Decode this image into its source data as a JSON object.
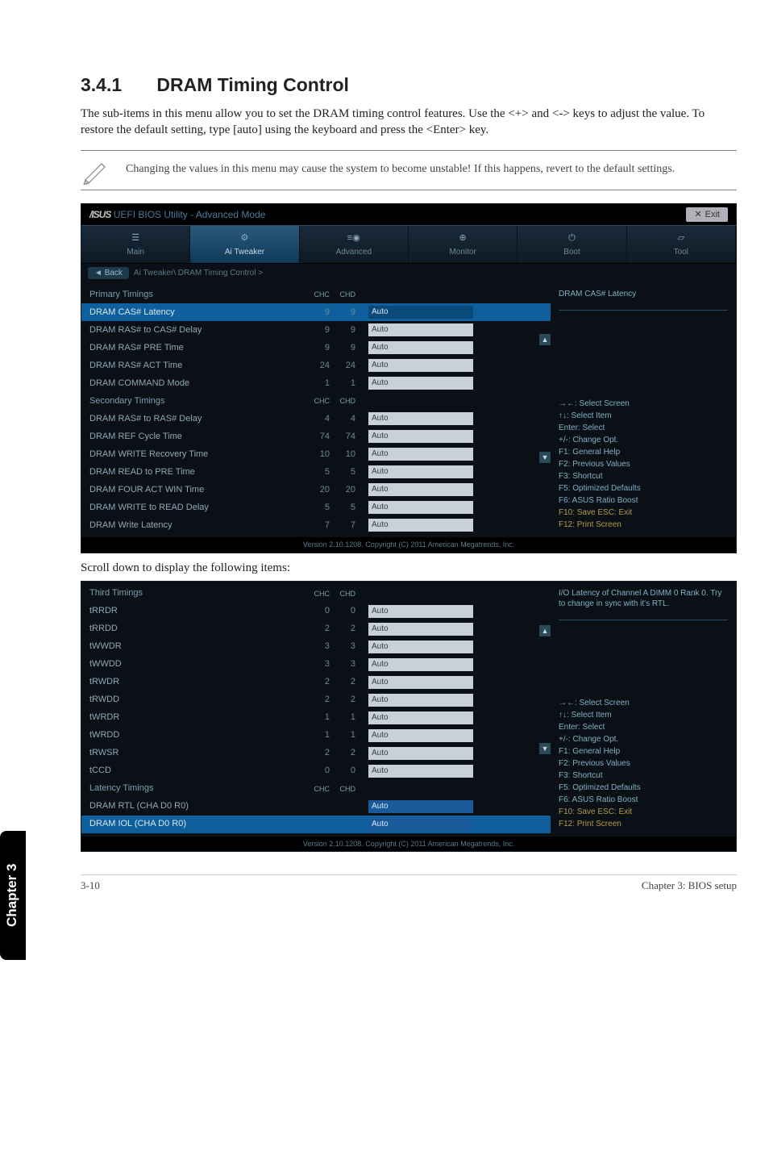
{
  "section": {
    "num": "3.4.1",
    "title": "DRAM Timing Control"
  },
  "intro": "The sub-items in this menu allow you to set the DRAM timing control features. Use the <+> and <-> keys to adjust the value. To restore the default setting, type [auto] using the keyboard and press the <Enter> key.",
  "note": "Changing the values in this menu may cause the system to become unstable! If this happens, revert to the default settings.",
  "subcap": "Scroll down to display the following items:",
  "side_tab": "Chapter 3",
  "footer": {
    "left": "3-10",
    "right": "Chapter 3: BIOS setup"
  },
  "bios_common": {
    "brand": "/ISUS",
    "util": "UEFI BIOS Utility - Advanced Mode",
    "exit": "Exit",
    "tabs": [
      {
        "label": "Main"
      },
      {
        "label": "Ai Tweaker",
        "active": true
      },
      {
        "label": "Advanced"
      },
      {
        "label": "Monitor"
      },
      {
        "label": "Boot"
      },
      {
        "label": "Tool"
      }
    ],
    "back": "Back",
    "crumb": "Ai Tweaker\\ DRAM Timing Control >",
    "footer": "Version 2.10.1208. Copyright (C) 2011 American Megatrends, Inc.",
    "col_hdr": {
      "a": "CHC",
      "b": "CHD"
    },
    "hints": [
      "→←: Select Screen",
      "↑↓: Select Item",
      "Enter: Select",
      "+/-: Change Opt.",
      "F1: General Help",
      "F2: Previous Values",
      "F3: Shortcut",
      "F5: Optimized Defaults",
      "F6: ASUS Ratio Boost",
      "F10: Save   ESC: Exit",
      "F12: Print Screen"
    ]
  },
  "bios1": {
    "help": "DRAM CAS# Latency",
    "rows": [
      {
        "type": "group",
        "label": "Primary Timings"
      },
      {
        "label": "DRAM CAS# Latency",
        "a": "9",
        "b": "9",
        "val": "Auto",
        "sel": true
      },
      {
        "label": "DRAM RAS# to CAS# Delay",
        "a": "9",
        "b": "9",
        "val": "Auto"
      },
      {
        "label": "DRAM RAS# PRE Time",
        "a": "9",
        "b": "9",
        "val": "Auto"
      },
      {
        "label": "DRAM RAS# ACT Time",
        "a": "24",
        "b": "24",
        "val": "Auto"
      },
      {
        "label": "DRAM COMMAND Mode",
        "a": "1",
        "b": "1",
        "val": "Auto"
      },
      {
        "type": "group",
        "label": "Secondary Timings"
      },
      {
        "label": "DRAM RAS# to RAS# Delay",
        "a": "4",
        "b": "4",
        "val": "Auto"
      },
      {
        "label": "DRAM REF Cycle Time",
        "a": "74",
        "b": "74",
        "val": "Auto"
      },
      {
        "label": "DRAM WRITE Recovery Time",
        "a": "10",
        "b": "10",
        "val": "Auto"
      },
      {
        "label": "DRAM READ to PRE Time",
        "a": "5",
        "b": "5",
        "val": "Auto"
      },
      {
        "label": "DRAM FOUR ACT WIN Time",
        "a": "20",
        "b": "20",
        "val": "Auto"
      },
      {
        "label": "DRAM WRITE to READ Delay",
        "a": "5",
        "b": "5",
        "val": "Auto"
      },
      {
        "label": "DRAM Write Latency",
        "a": "7",
        "b": "7",
        "val": "Auto"
      }
    ]
  },
  "bios2": {
    "help": "I/O Latency of Channel A DIMM 0 Rank 0. Try to change in sync with it's RTL.",
    "rows": [
      {
        "type": "group",
        "label": "Third Timings"
      },
      {
        "label": "tRRDR",
        "a": "0",
        "b": "0",
        "val": "Auto"
      },
      {
        "label": "tRRDD",
        "a": "2",
        "b": "2",
        "val": "Auto"
      },
      {
        "label": "tWWDR",
        "a": "3",
        "b": "3",
        "val": "Auto"
      },
      {
        "label": "tWWDD",
        "a": "3",
        "b": "3",
        "val": "Auto"
      },
      {
        "label": "tRWDR",
        "a": "2",
        "b": "2",
        "val": "Auto"
      },
      {
        "label": "tRWDD",
        "a": "2",
        "b": "2",
        "val": "Auto"
      },
      {
        "label": "tWRDR",
        "a": "1",
        "b": "1",
        "val": "Auto"
      },
      {
        "label": "tWRDD",
        "a": "1",
        "b": "1",
        "val": "Auto"
      },
      {
        "label": "tRWSR",
        "a": "2",
        "b": "2",
        "val": "Auto"
      },
      {
        "label": "tCCD",
        "a": "0",
        "b": "0",
        "val": "Auto"
      },
      {
        "type": "group",
        "label": "Latency Timings"
      },
      {
        "label": "DRAM RTL (CHA D0 R0)",
        "a": "",
        "b": "",
        "val": "Auto",
        "alt": true
      },
      {
        "label": "DRAM IOL (CHA D0 R0)",
        "a": "",
        "b": "",
        "val": "Auto",
        "sel": true,
        "alt": true
      }
    ]
  }
}
